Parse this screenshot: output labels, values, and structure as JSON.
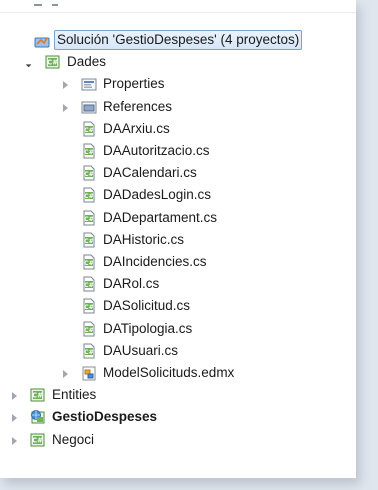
{
  "solution": {
    "label": "Solución 'GestioDespeses' (4 proyectos)",
    "icon": "solution-icon"
  },
  "dades": {
    "label": "Dades",
    "icon": "csharp-project-icon",
    "folders": [
      {
        "label": "Properties",
        "icon": "properties-icon"
      },
      {
        "label": "References",
        "icon": "references-icon"
      }
    ],
    "files": [
      "DAArxiu.cs",
      "DAAutoritzacio.cs",
      "DACalendari.cs",
      "DADadesLogin.cs",
      "DADepartament.cs",
      "DAHistoric.cs",
      "DAIncidencies.cs",
      "DARol.cs",
      "DASolicitud.cs",
      "DATipologia.cs",
      "DAUsuari.cs"
    ],
    "edmx": {
      "label": "ModelSolicituds.edmx",
      "icon": "edmx-icon"
    }
  },
  "projects": [
    {
      "label": "Entities",
      "icon": "csharp-project-icon"
    },
    {
      "label": "GestioDespeses",
      "icon": "web-project-icon"
    },
    {
      "label": "Negoci",
      "icon": "csharp-project-icon"
    }
  ]
}
